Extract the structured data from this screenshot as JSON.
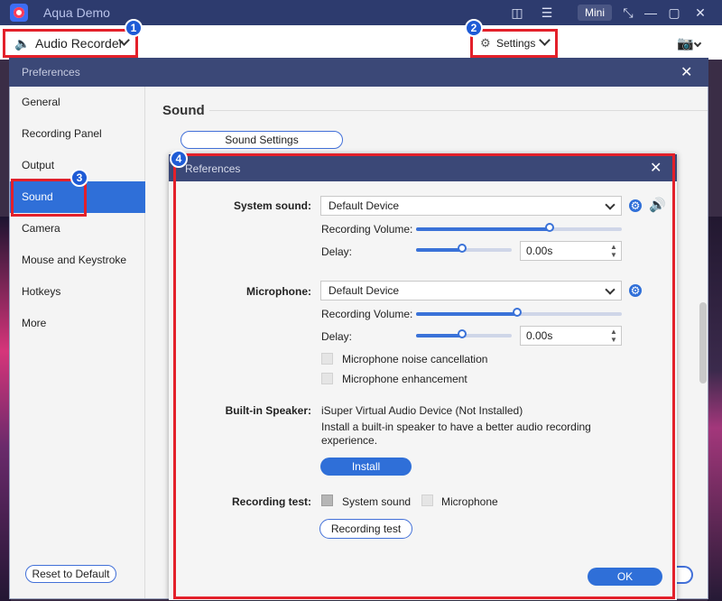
{
  "app": {
    "title": "Aqua Demo",
    "mini_label": "Mini",
    "recorder_mode": "Audio Recorder",
    "settings_label": "Settings"
  },
  "callouts": [
    "1",
    "2",
    "3",
    "4"
  ],
  "preferences": {
    "title": "Preferences",
    "sidebar": [
      {
        "label": "General"
      },
      {
        "label": "Recording Panel"
      },
      {
        "label": "Output"
      },
      {
        "label": "Sound",
        "active": true
      },
      {
        "label": "Camera"
      },
      {
        "label": "Mouse and Keystroke"
      },
      {
        "label": "Hotkeys"
      },
      {
        "label": "More"
      }
    ],
    "section_title": "Sound",
    "sound_settings_label": "Sound Settings",
    "reset_label": "Reset to Default"
  },
  "dialog": {
    "title": "References",
    "system_sound": {
      "label": "System sound:",
      "device": "Default Device",
      "volume_label": "Recording Volume:",
      "volume": 0.66,
      "delay_label": "Delay:",
      "delay_value": "0.00s",
      "delay_position": 0.5
    },
    "microphone": {
      "label": "Microphone:",
      "device": "Default Device",
      "volume_label": "Recording Volume:",
      "volume": 0.5,
      "delay_label": "Delay:",
      "delay_value": "0.00s",
      "delay_position": 0.5,
      "noise_cancellation": "Microphone noise cancellation",
      "enhancement": "Microphone enhancement"
    },
    "speaker": {
      "label": "Built-in Speaker:",
      "device": "iSuper Virtual Audio Device (Not Installed)",
      "description": "Install a built-in speaker to have a better audio recording experience.",
      "install_label": "Install"
    },
    "recording_test": {
      "label": "Recording test:",
      "system_sound": "System sound",
      "microphone": "Microphone",
      "button": "Recording test"
    },
    "ok_label": "OK"
  },
  "colors": {
    "accent": "#2f6fd8",
    "highlight": "#e3202a",
    "titlebar": "#3b4877"
  }
}
